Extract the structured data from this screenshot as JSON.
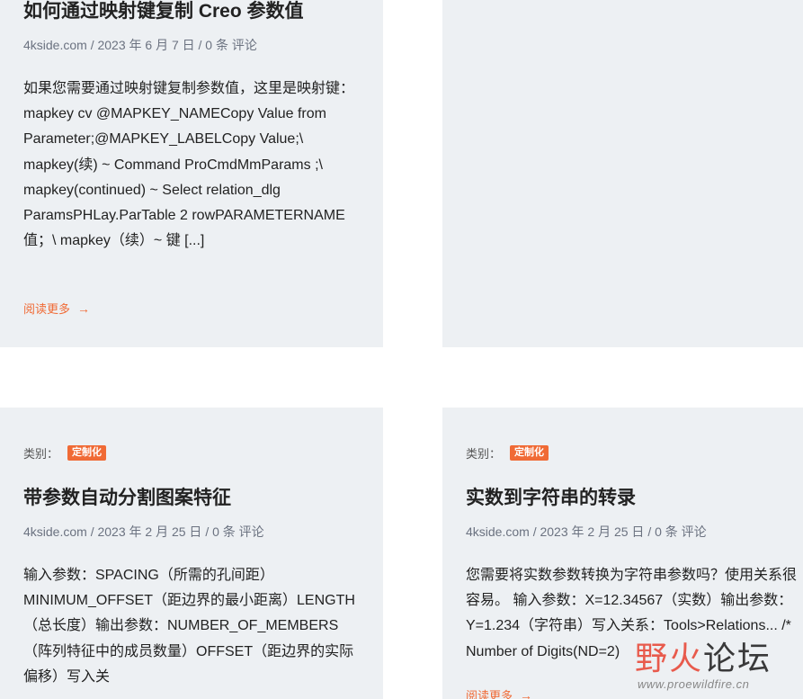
{
  "posts": [
    {
      "title": "如何通过映射键复制 Creo 参数值",
      "meta": "4kside.com / 2023 年 6 月 7 日 / 0 条 评论",
      "excerpt": "如果您需要通过映射键复制参数值，这里是映射键：mapkey cv @MAPKEY_NAMECopy Value from Parameter;@MAPKEY_LABELCopy Value;\\ mapkey(续) ~ Command ProCmdMmParams ;\\ mapkey(continued) ~ Select relation_dlg ParamsPHLay.ParTable 2 rowPARAMETERNAME值；\\ mapkey（续）~ 键 [...]",
      "read_more": "阅读更多"
    },
    {
      "category_label": "类别：",
      "category": "定制化",
      "title": "带参数自动分割图案特征",
      "meta": "4kside.com / 2023 年 2 月 25 日 / 0 条 评论",
      "excerpt": "输入参数：SPACING（所需的孔间距）MINIMUM_OFFSET（距边界的最小距离）LENGTH（总长度）输出参数：NUMBER_OF_MEMBERS（阵列特征中的成员数量）OFFSET（距边界的实际偏移）写入关"
    },
    {
      "category_label": "类别：",
      "category": "定制化",
      "title": "实数到字符串的转录",
      "meta": "4kside.com / 2023 年 2 月 25 日 / 0 条 评论",
      "excerpt": "您需要将实数参数转换为字符串参数吗？使用关系很容易。 输入参数：X=12.34567（实数）输出参数：Y=1.234（字符串）写入关系：Tools>Relations... /* Number of Digits(ND=2)",
      "read_more": "阅读更多"
    }
  ],
  "watermark": {
    "cn_part1": "野火",
    "cn_part2": "论坛",
    "url": "www.proewildfire.cn"
  },
  "colors": {
    "accent": "#f06a35",
    "card_bg": "#edf0f3",
    "meta_text": "#6b7280"
  }
}
